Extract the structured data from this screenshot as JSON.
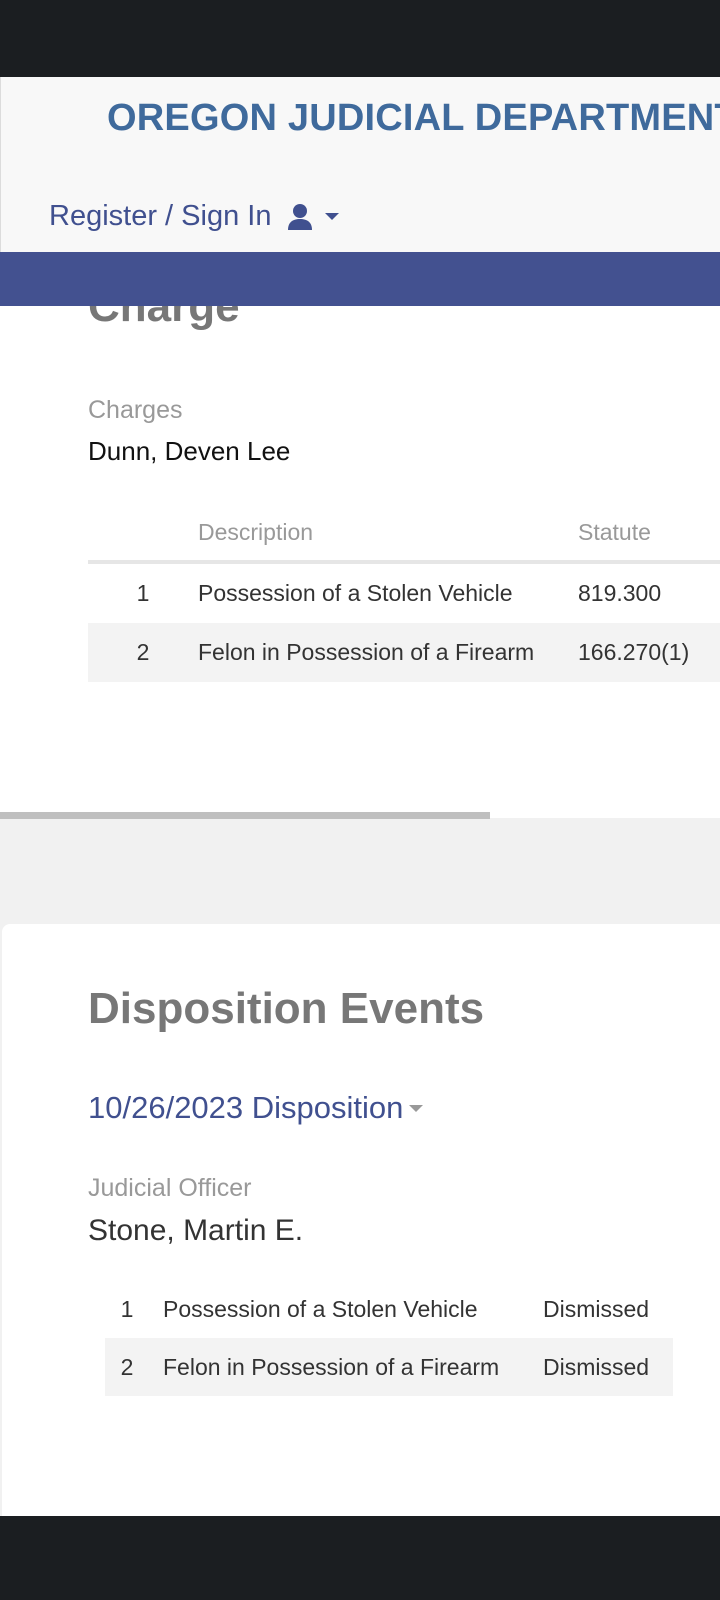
{
  "header": {
    "org_title": "OREGON JUDICIAL DEPARTMENT",
    "signin_label": "Register / Sign In",
    "signin_icon": "user-icon",
    "accent_color": "#435190"
  },
  "charge_section": {
    "heading": "Charge",
    "label": "Charges",
    "party": "Dunn, Deven Lee",
    "columns": [
      "",
      "Description",
      "Statute"
    ],
    "rows": [
      {
        "num": "1",
        "description": "Possession of a Stolen Vehicle",
        "statute": "819.300"
      },
      {
        "num": "2",
        "description": "Felon in Possession of a Firearm",
        "statute": "166.270(1)"
      }
    ]
  },
  "disposition_section": {
    "heading": "Disposition Events",
    "event_toggle": "10/26/2023 Disposition",
    "officer_label": "Judicial Officer",
    "officer_name": "Stone, Martin E.",
    "rows": [
      {
        "num": "1",
        "description": "Possession of a Stolen Vehicle",
        "result": "Dismissed"
      },
      {
        "num": "2",
        "description": "Felon in Possession of a Firearm",
        "result": "Dismissed"
      }
    ]
  }
}
